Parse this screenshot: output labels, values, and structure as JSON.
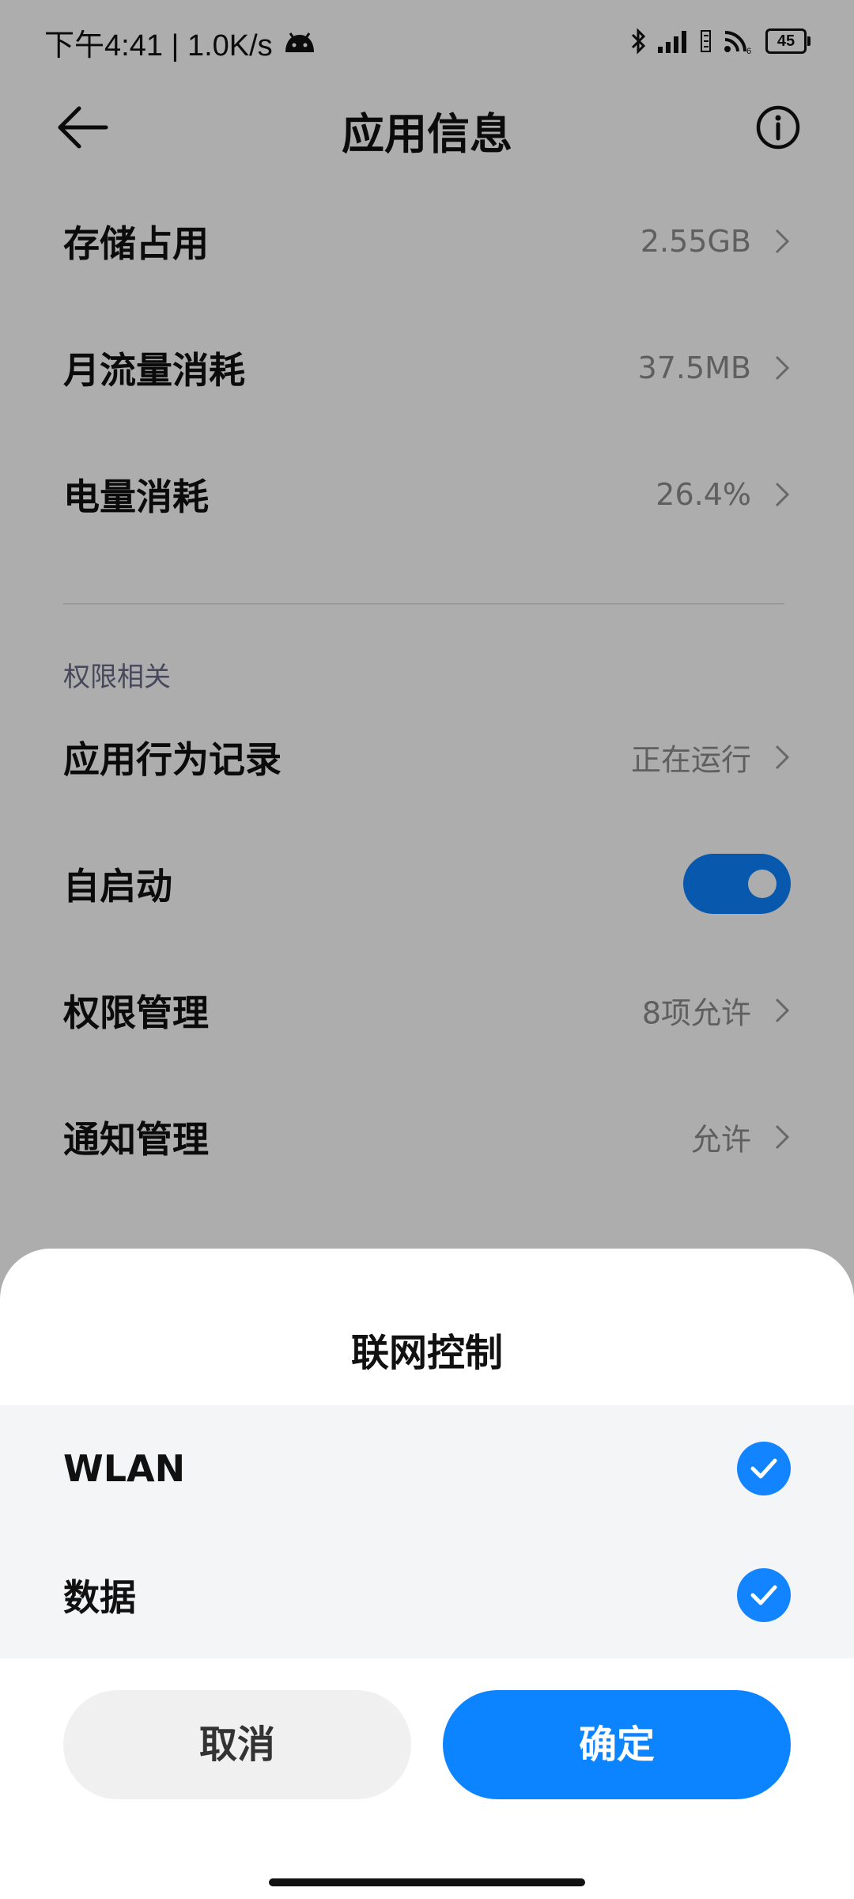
{
  "status_bar": {
    "time_speed": "下午4:41 | 1.0K/s",
    "battery": "45"
  },
  "header": {
    "title": "应用信息",
    "back_icon": "arrow-left-icon",
    "info_icon": "info-circle-icon"
  },
  "usage_rows": [
    {
      "label": "存储占用",
      "value": "2.55GB"
    },
    {
      "label": "月流量消耗",
      "value": "37.5MB"
    },
    {
      "label": "电量消耗",
      "value": "26.4%"
    }
  ],
  "permissions": {
    "section_label": "权限相关",
    "behavior_log": {
      "label": "应用行为记录",
      "value": "正在运行"
    },
    "autostart": {
      "label": "自启动",
      "enabled": true
    },
    "permission_mgmt": {
      "label": "权限管理",
      "value": "8项允许"
    },
    "notification_mgmt": {
      "label": "通知管理",
      "value": "允许"
    }
  },
  "sheet": {
    "title": "联网控制",
    "options": [
      {
        "label": "WLAN",
        "checked": true
      },
      {
        "label": "数据",
        "checked": true
      }
    ],
    "cancel_label": "取消",
    "confirm_label": "确定"
  },
  "colors": {
    "accent": "#0d84ff",
    "scrim": "rgba(0,0,0,0.32)"
  }
}
